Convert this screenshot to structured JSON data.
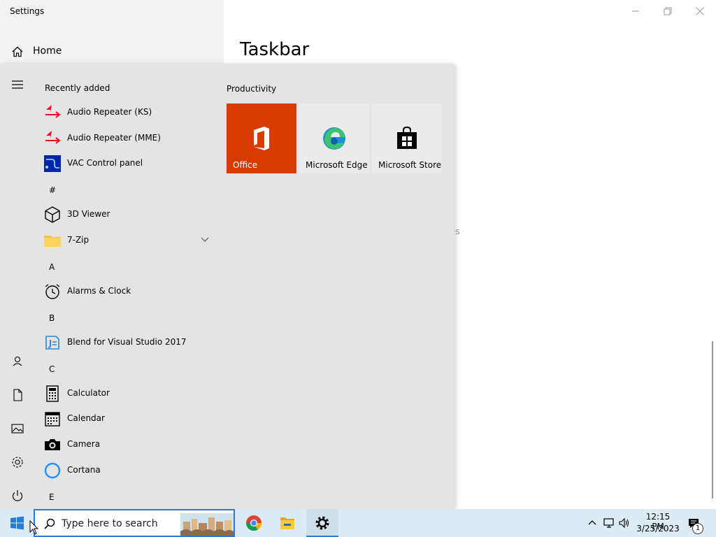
{
  "window": {
    "title": "Settings",
    "home_label": "Home",
    "heading": "Taskbar",
    "peek_text": "es"
  },
  "start_menu": {
    "recently_added_title": "Recently added",
    "recent_apps": [
      {
        "label": "Audio Repeater (KS)",
        "icon": "audio-repeater-icon"
      },
      {
        "label": "Audio Repeater (MME)",
        "icon": "audio-repeater-icon"
      },
      {
        "label": "VAC Control panel",
        "icon": "vac-control-icon"
      }
    ],
    "groups": [
      {
        "letter": "#",
        "apps": [
          {
            "label": "3D Viewer",
            "icon": "cube-icon"
          },
          {
            "label": "7-Zip",
            "icon": "folder-icon",
            "expandable": true
          }
        ]
      },
      {
        "letter": "A",
        "apps": [
          {
            "label": "Alarms & Clock",
            "icon": "alarm-clock-icon"
          }
        ]
      },
      {
        "letter": "B",
        "apps": [
          {
            "label": "Blend for Visual Studio 2017",
            "icon": "blend-icon"
          }
        ]
      },
      {
        "letter": "C",
        "apps": [
          {
            "label": "Calculator",
            "icon": "calculator-icon"
          },
          {
            "label": "Calendar",
            "icon": "calendar-icon"
          },
          {
            "label": "Camera",
            "icon": "camera-icon"
          },
          {
            "label": "Cortana",
            "icon": "cortana-icon"
          }
        ]
      },
      {
        "letter": "E",
        "apps": []
      }
    ],
    "tiles_group_title": "Productivity",
    "tiles": [
      {
        "label": "Office",
        "icon": "office-icon",
        "bg": "#d83b01",
        "fg": "#ffffff"
      },
      {
        "label": "Microsoft Edge",
        "icon": "edge-icon",
        "bg": "#ebebeb",
        "fg": "#000000"
      },
      {
        "label": "Microsoft Store",
        "icon": "store-icon",
        "bg": "#ebebeb",
        "fg": "#000000"
      }
    ]
  },
  "taskbar": {
    "search_placeholder": "Type here to search",
    "time": "12:15 PM",
    "date": "3/25/2023",
    "notification_count": "1"
  },
  "colors": {
    "accent": "#2a7bd6",
    "office_orange": "#d83b01"
  }
}
